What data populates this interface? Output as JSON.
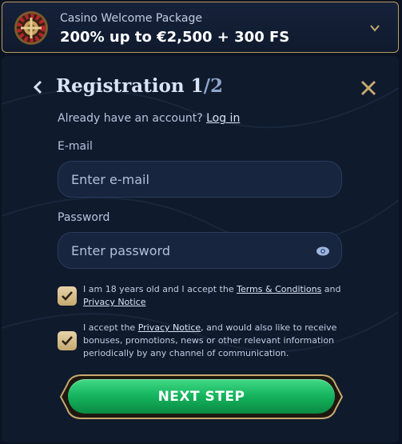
{
  "banner": {
    "subtitle": "Casino Welcome Package",
    "title": "200% up to €2,500 + 300 FS",
    "icon": "roulette-icon",
    "expand_icon": "chevron-down-icon"
  },
  "header": {
    "title": "Registration",
    "step_current": "1",
    "step_total": "/2",
    "back_icon": "chevron-left-icon",
    "close_icon": "close-icon"
  },
  "account": {
    "prompt": "Already have an account?",
    "login_link": "Log in"
  },
  "email": {
    "label": "E-mail",
    "placeholder": "Enter e-mail",
    "value": ""
  },
  "password": {
    "label": "Password",
    "placeholder": "Enter password",
    "value": "",
    "toggle_icon": "eye-icon"
  },
  "consent_terms": {
    "checked": true,
    "text_before": "I am 18 years old and I accept the ",
    "terms_link": "Terms & Conditions",
    "text_and": " and ",
    "privacy_link": "Privacy Notice"
  },
  "consent_marketing": {
    "checked": true,
    "text_before": "I accept the ",
    "privacy_link": "Privacy Notice",
    "text_after": ", and would also like to receive bonuses, promotions, news or other relevant information periodically by any channel of communication."
  },
  "actions": {
    "next_label": "NEXT STEP"
  },
  "colors": {
    "background": "#0b1322",
    "panel": "#0f1a2c",
    "accent_gold": "#c6a970",
    "button_green": "#14b35c"
  }
}
